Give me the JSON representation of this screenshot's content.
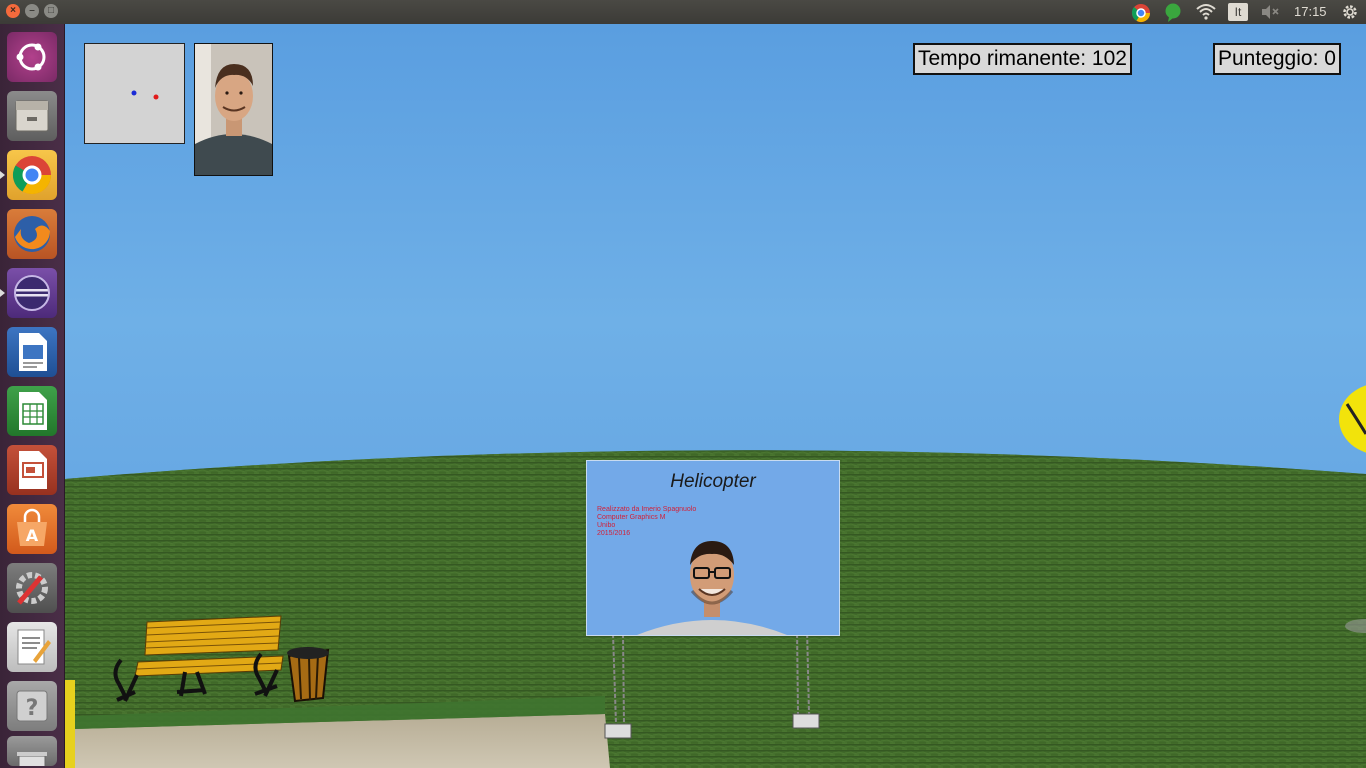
{
  "topbar": {
    "keyboard_layout": "It",
    "clock": "17:15"
  },
  "launcher": {
    "items": [
      {
        "name": "Dash"
      },
      {
        "name": "Files"
      },
      {
        "name": "Google Chrome"
      },
      {
        "name": "Firefox"
      },
      {
        "name": "Eclipse"
      },
      {
        "name": "LibreOffice Writer"
      },
      {
        "name": "LibreOffice Calc"
      },
      {
        "name": "LibreOffice Impress"
      },
      {
        "name": "Ubuntu Software Center"
      },
      {
        "name": "System Settings"
      },
      {
        "name": "Text Editor"
      },
      {
        "name": "Help"
      }
    ]
  },
  "hud": {
    "time_left": "Tempo rimanente: 102",
    "score": "Punteggio: 0"
  },
  "billboard": {
    "title": "Helicopter",
    "line1": "Realizzato da Imerio Spagnuolo",
    "line2": "Computer Graphics M",
    "line3": "Unibo",
    "line4": "2015/2016"
  },
  "colors": {
    "sky_top": "#6aace6",
    "grass": "#3f6a2a",
    "launcher_bg": "#4a2e47",
    "billboard_bg": "#73a9e8",
    "billboard_text": "#d0213a"
  }
}
